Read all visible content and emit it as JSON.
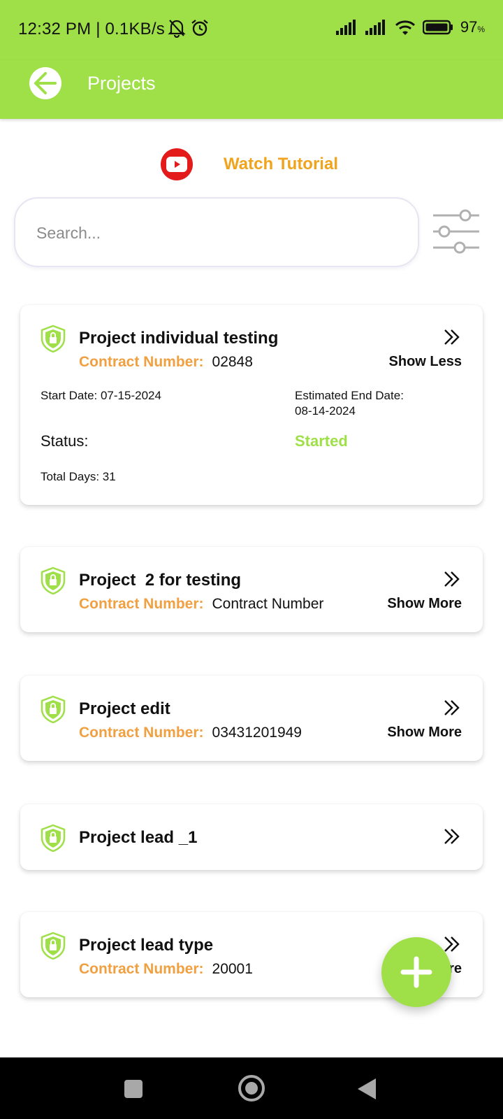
{
  "status_bar": {
    "time": "12:32 PM | 0.1KB/s",
    "battery": "97",
    "battery_unit": "%",
    "icons": [
      "mute-bell-icon",
      "alarm-icon",
      "signal-icon",
      "signal-icon",
      "wifi-icon",
      "battery-icon"
    ]
  },
  "appbar": {
    "title": "Projects"
  },
  "tutorial": {
    "label": "Watch Tutorial"
  },
  "search": {
    "placeholder": "Search..."
  },
  "contract_key": "Contract Number:",
  "projects": [
    {
      "name": "Project individual testing",
      "contract_number": "02848",
      "toggle": "Show Less",
      "start_date": "Start Date: 07-15-2024",
      "end_date_label": "Estimated End Date:",
      "end_date": "08-14-2024",
      "status_label": "Status:",
      "status": "Started",
      "total_days": "Total Days: 31"
    },
    {
      "name": "Project  2 for testing",
      "contract_number": "Contract Number",
      "toggle": "Show More"
    },
    {
      "name": "Project edit",
      "contract_number": "03431201949",
      "toggle": "Show More"
    },
    {
      "name": "Project lead _1"
    },
    {
      "name": "Project lead type",
      "contract_number": "20001",
      "toggle": "re"
    }
  ],
  "colors": {
    "accent": "#9fe048",
    "orange": "#f0a041",
    "tutorial": "#f0a41d",
    "youtube": "#e31b1b"
  }
}
